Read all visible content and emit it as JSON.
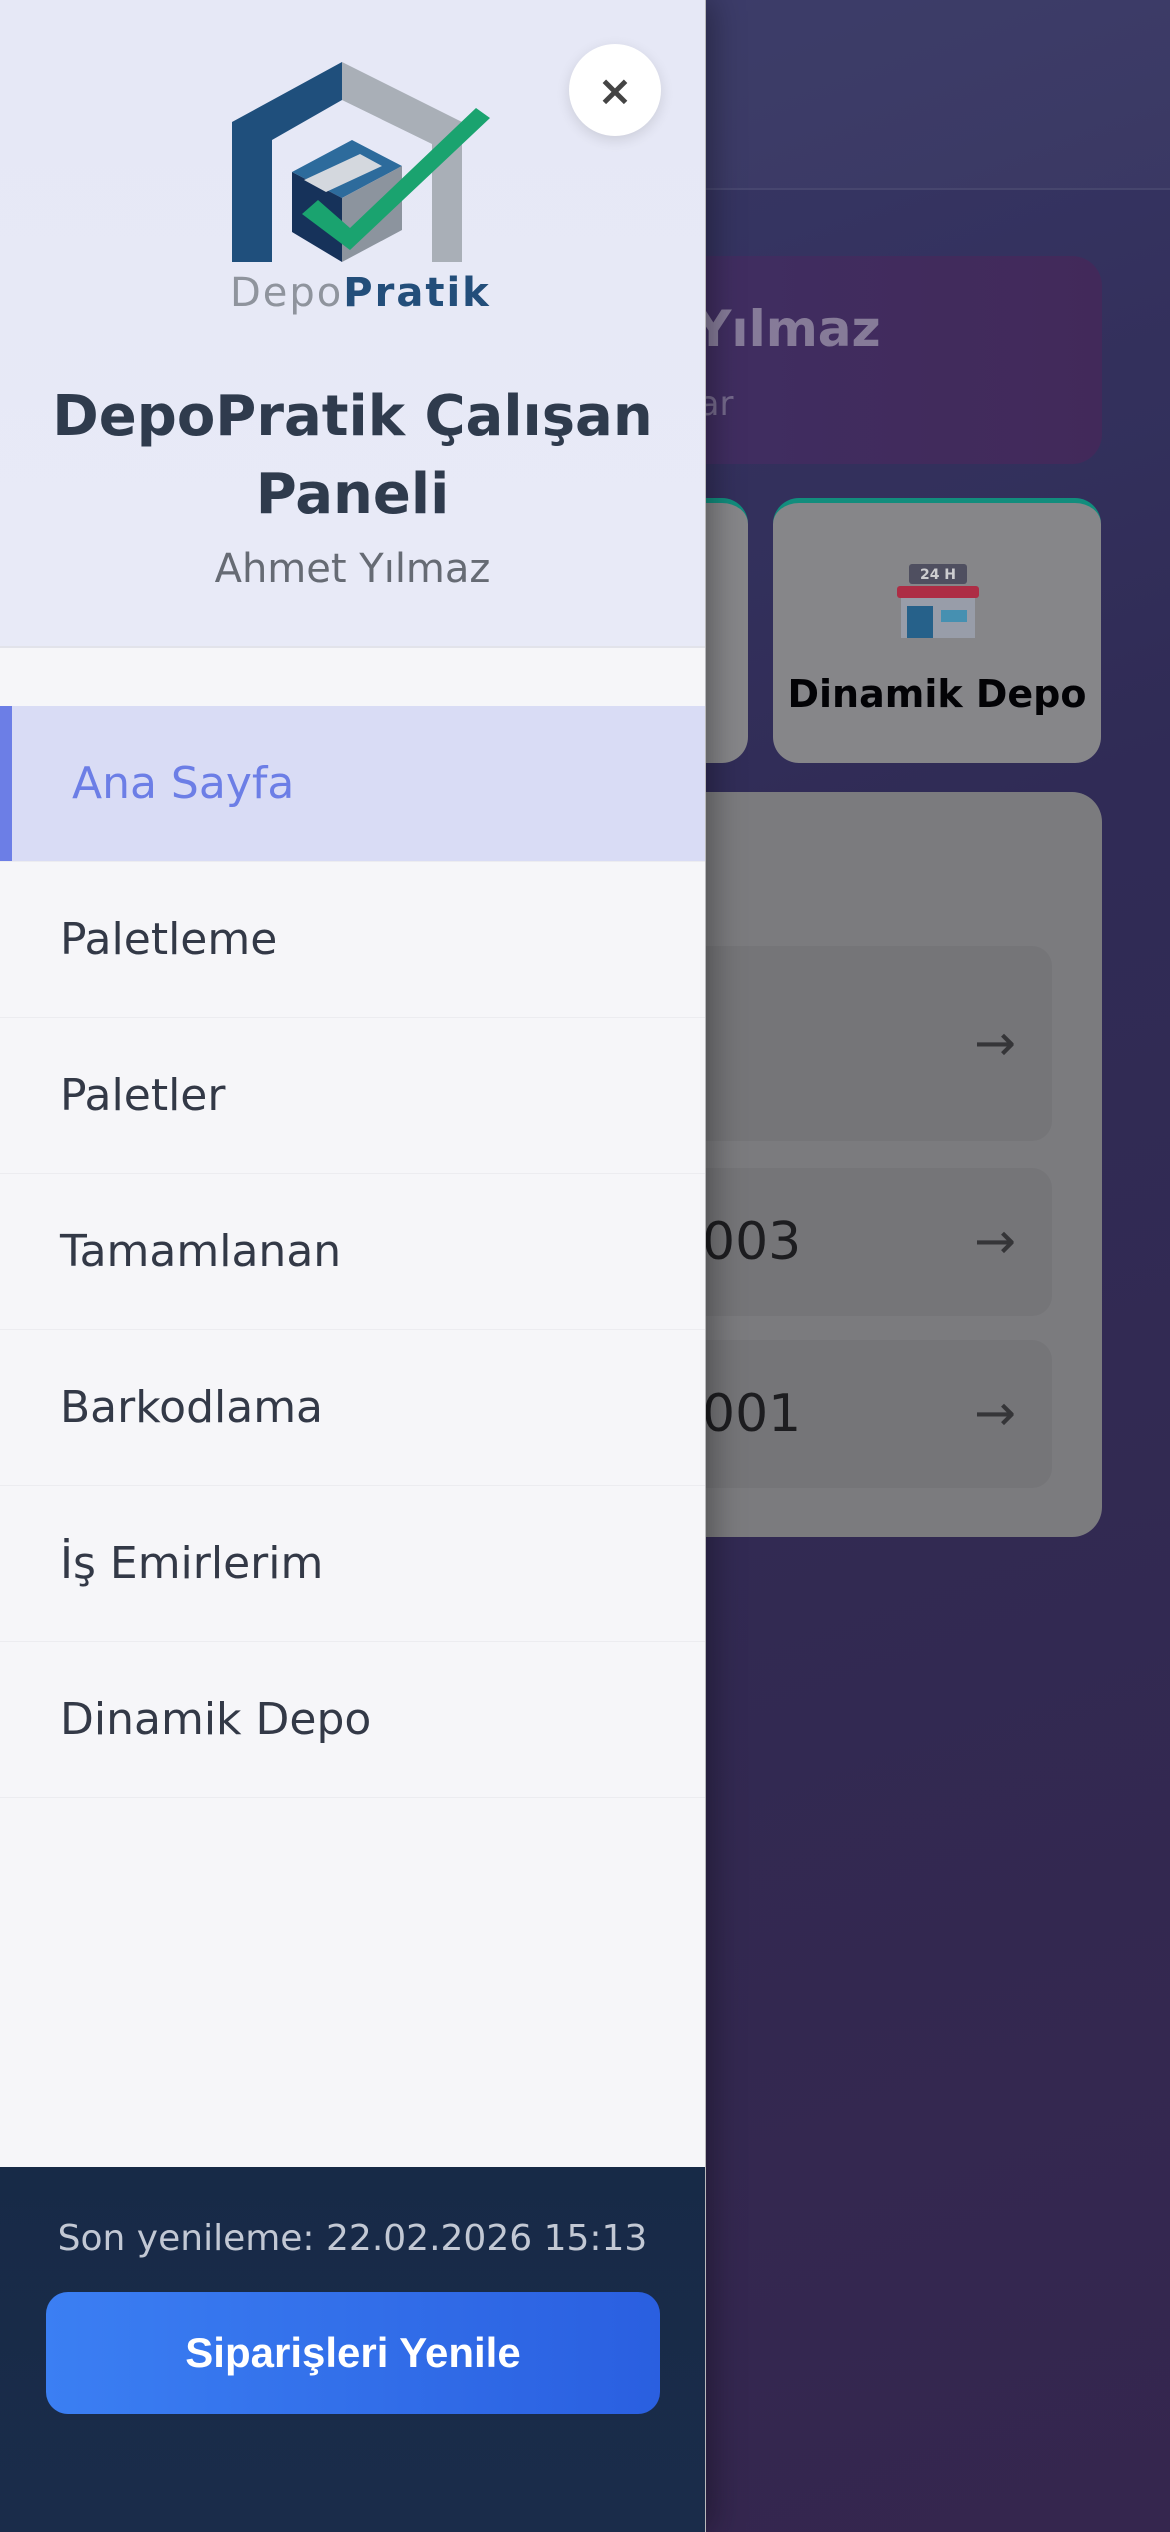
{
  "background": {
    "user_name_fragment": "et Yılmaz",
    "user_role_fragment": "azar",
    "tile_label": "Dinamik Depo",
    "store_sign": "24 H",
    "rows": [
      {
        "text": "",
        "arrow": "→"
      },
      {
        "text": "003",
        "arrow": "→"
      },
      {
        "text": "001",
        "arrow": "→"
      }
    ]
  },
  "drawer": {
    "close_label": "×",
    "logo_depo": "Depo",
    "logo_pratik": "Pratik",
    "title": "DepoPratik Çalışan Paneli",
    "user_name": "Ahmet Yılmaz",
    "menu": [
      {
        "label": "Ana Sayfa",
        "active": true
      },
      {
        "label": "Paletleme",
        "active": false
      },
      {
        "label": "Paletler",
        "active": false
      },
      {
        "label": "Tamamlanan",
        "active": false
      },
      {
        "label": "Barkodlama",
        "active": false
      },
      {
        "label": "İş Emirlerim",
        "active": false
      },
      {
        "label": "Dinamik Depo",
        "active": false
      }
    ],
    "footer": {
      "last_refresh": "Son yenileme: 22.02.2026 15:13",
      "refresh_button": "Siparişleri Yenile"
    }
  },
  "colors": {
    "accent": "#6c7ee6",
    "button": "#2f6ef0",
    "footer": "#172a47"
  }
}
